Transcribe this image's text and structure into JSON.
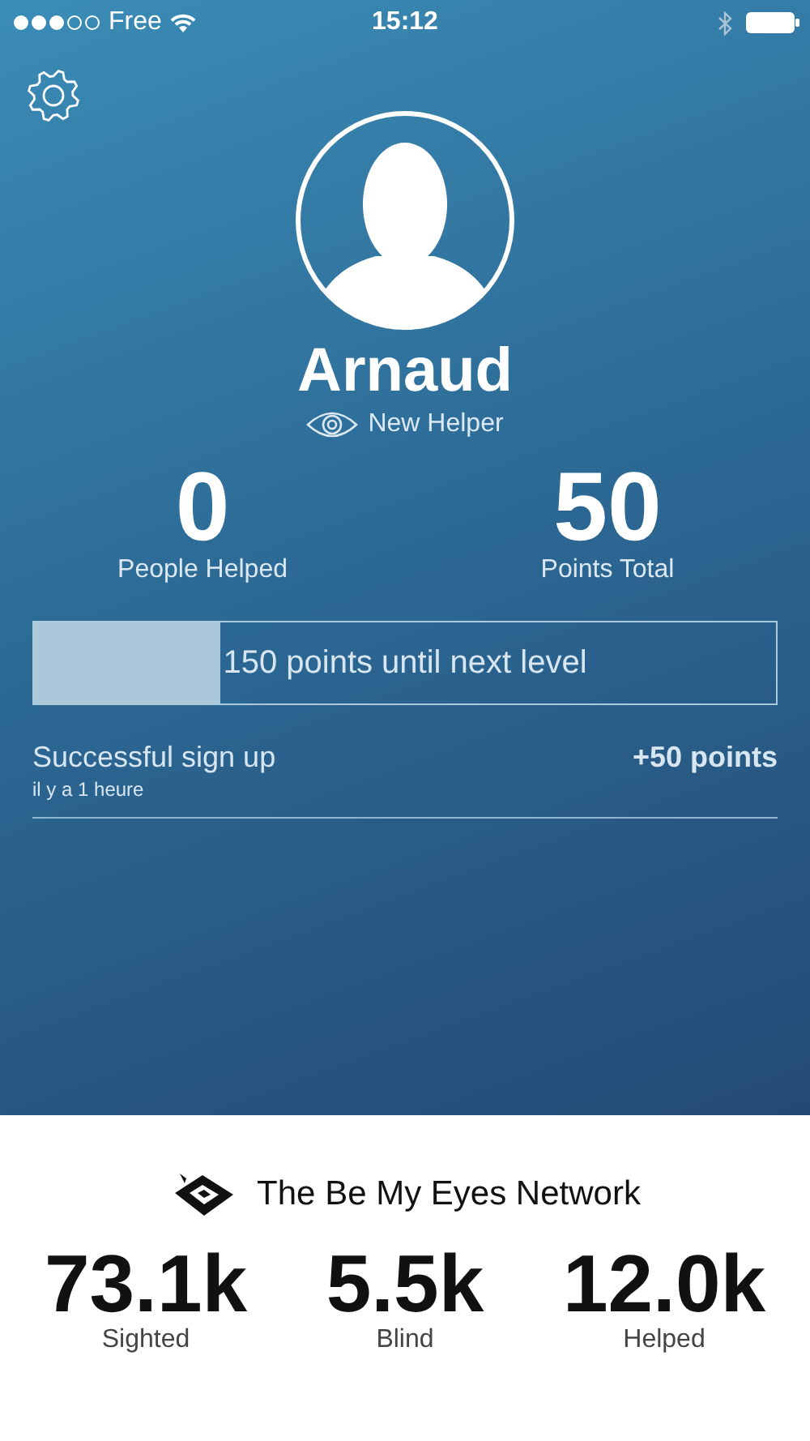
{
  "status_bar": {
    "carrier": "Free",
    "time": "15:12"
  },
  "profile": {
    "name": "Arnaud",
    "rank": "New Helper"
  },
  "stats": [
    {
      "value": "0",
      "label": "People Helped"
    },
    {
      "value": "50",
      "label": "Points Total"
    }
  ],
  "progress": {
    "level": 0.25,
    "label": "150 points until next level"
  },
  "activity": [
    {
      "title": "Successful sign up",
      "time": "il y a 1 heure",
      "points": "+50 points"
    }
  ],
  "network": {
    "title": "The Be My Eyes Network",
    "stats": [
      {
        "value": "73.1k",
        "label": "Sighted"
      },
      {
        "value": "5.5k",
        "label": "Blind"
      },
      {
        "value": "12.0k",
        "label": "Helped"
      }
    ]
  }
}
